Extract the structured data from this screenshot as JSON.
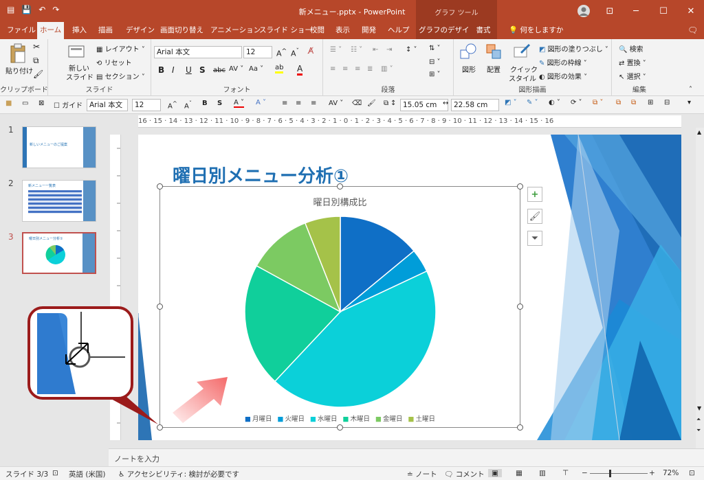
{
  "window": {
    "title": "新メニュー.pptx  -  PowerPoint",
    "context_header": "グラフ ツール",
    "minimize": "─",
    "maximize": "☐",
    "close": "✕"
  },
  "tabs": [
    "ファイル",
    "ホーム",
    "挿入",
    "描画",
    "デザイン",
    "画面切り替え",
    "アニメーション",
    "スライド ショー",
    "校閲",
    "表示",
    "開発",
    "ヘルプ",
    "グラフのデザイン",
    "書式"
  ],
  "active_tab": "ホーム",
  "tell_me": "何をしますか",
  "ribbon": {
    "clipboard": {
      "label": "クリップボード",
      "paste": "貼り付け"
    },
    "slides": {
      "label": "スライド",
      "new_slide_1": "新しい",
      "new_slide_2": "スライド",
      "layout": "レイアウト",
      "reset": "リセット",
      "section": "セクション"
    },
    "font": {
      "label": "フォント",
      "font_name": "Arial 本文",
      "font_size": "12"
    },
    "paragraph": {
      "label": "段落"
    },
    "drawing": {
      "label": "図形描画",
      "shapes": "図形",
      "arrange": "配置",
      "quick_style_1": "クイック",
      "quick_style_2": "スタイル",
      "fill": "図形の塗りつぶし",
      "outline": "図形の枠線",
      "effect": "図形の効果"
    },
    "editing": {
      "label": "編集",
      "find": "検索",
      "replace": "置換",
      "select": "選択"
    }
  },
  "format_bar": {
    "guide": "ガイド",
    "font_name": "Arial 本文",
    "font_size": "12",
    "height": "15.05 cm",
    "width": "22.58 cm"
  },
  "ruler_text": "16 · 15 · 14 · 13 · 12 · 11 · 10 · 9 · 8 · 7 · 6 · 5 · 4 · 3 · 2 · 1 · 0 · 1 · 2 · 3 · 4 · 5 · 6 · 7 · 8 · 9 · 10 · 11 · 12 · 13 · 14 · 15 · 16",
  "thumbnails": [
    {
      "num": "1",
      "title": "新しいメニューのご提案"
    },
    {
      "num": "2",
      "title": "新メニュー一覧表"
    },
    {
      "num": "3",
      "title": "曜日別メニュー分析①"
    }
  ],
  "slide": {
    "title": "曜日別メニュー分析①"
  },
  "chart_data": {
    "type": "pie",
    "title": "曜日別構成比",
    "categories": [
      "月曜日",
      "火曜日",
      "水曜日",
      "木曜日",
      "金曜日",
      "土曜日"
    ],
    "values": [
      14,
      4,
      44,
      21,
      11,
      6
    ],
    "colors": [
      "#0f6fc6",
      "#009dd9",
      "#0bd0d9",
      "#10cf9b",
      "#7cca62",
      "#a5c249"
    ],
    "legend_position": "bottom"
  },
  "notes_placeholder": "ノートを入力",
  "status": {
    "slide": "スライド 3/3",
    "language": "英語 (米国)",
    "accessibility": "アクセシビリティ: 検討が必要です",
    "notes": "ノート",
    "comments": "コメント",
    "zoom": "72%"
  }
}
